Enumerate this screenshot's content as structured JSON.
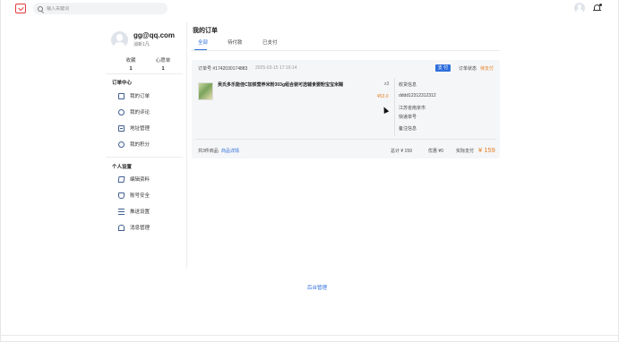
{
  "header": {
    "search_placeholder": "输入关键词"
  },
  "user": {
    "email": "gg@qq.com",
    "level": "消新1凡",
    "stats": [
      {
        "label": "收藏",
        "value": "1"
      },
      {
        "label": "心愿单",
        "value": "1"
      }
    ]
  },
  "sidebar": {
    "order_center_title": "订单中心",
    "order_items": [
      {
        "label": "我的订单",
        "icon": "order-icon"
      },
      {
        "label": "我的评论",
        "icon": "comment-icon"
      },
      {
        "label": "地址管理",
        "icon": "address-icon"
      },
      {
        "label": "我的积分",
        "icon": "points-icon"
      }
    ],
    "settings_title": "个人设置",
    "settings_items": [
      {
        "label": "编辑资料",
        "icon": "edit-icon"
      },
      {
        "label": "账号安全",
        "icon": "security-icon"
      },
      {
        "label": "推送设置",
        "icon": "push-settings-icon"
      },
      {
        "label": "消息管理",
        "icon": "message-icon"
      }
    ]
  },
  "main": {
    "title": "我的订单",
    "tabs": [
      {
        "label": "全部",
        "active": true
      },
      {
        "label": "待付款",
        "active": false
      },
      {
        "label": "已支付",
        "active": false
      }
    ],
    "order": {
      "order_no": "订单号 #1742030174883",
      "time": "2025-03-15 17:16:14",
      "pay_button": "支 付",
      "status_label": "订单状态",
      "status_value": "待支付",
      "product_name": "吴氏多乐能佳C加铁营养米粉303g组合装可选辅食婴粉宝宝米糊",
      "quantity": "x3",
      "price": "¥53.0",
      "receiver_title": "收货信息",
      "receiver_name": "dddd12312312312",
      "receiver_address": "江苏省南京市",
      "express_label": "快递单号",
      "remark_label": "备注信息",
      "total_count": "共3件商品",
      "detail_link": "商品详情",
      "total_label": "总计 ¥ 159",
      "discount_label": "优惠 ¥0",
      "actual_label": "实际支付",
      "actual_value": "¥ 159"
    },
    "footer_link": "后台管理"
  },
  "colors": {
    "accent": "#2f6fdc",
    "price": "#e67e22",
    "brand_red": "#e4393c"
  }
}
